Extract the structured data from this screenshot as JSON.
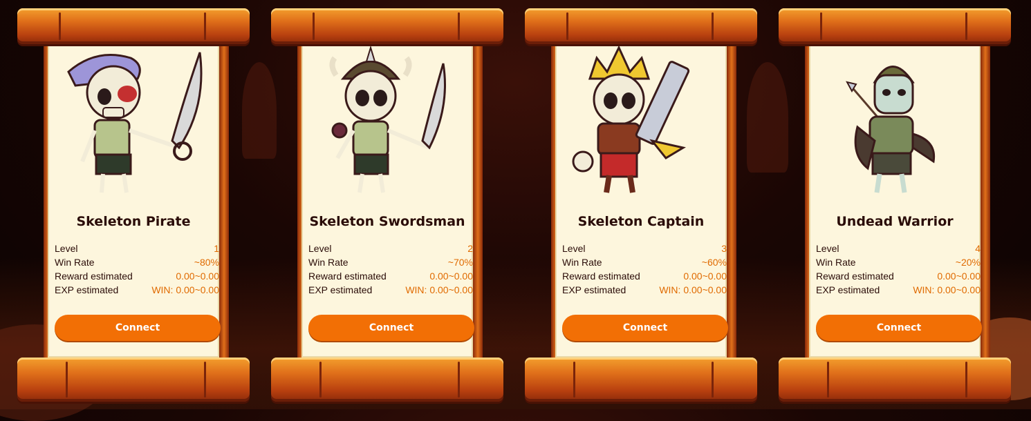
{
  "cards": [
    {
      "name": "Skeleton Pirate",
      "stats": {
        "level_label": "Level",
        "level": "1",
        "win_label": "Win Rate",
        "win": "~80%",
        "reward_label": "Reward estimated",
        "reward": "0.00~0.00",
        "exp_label": "EXP estimated",
        "exp": "WIN: 0.00~0.00"
      },
      "button": "Connect",
      "avatar": "skeleton-pirate-icon"
    },
    {
      "name": "Skeleton Swordsman",
      "stats": {
        "level_label": "Level",
        "level": "2",
        "win_label": "Win Rate",
        "win": "~70%",
        "reward_label": "Reward estimated",
        "reward": "0.00~0.00",
        "exp_label": "EXP estimated",
        "exp": "WIN: 0.00~0.00"
      },
      "button": "Connect",
      "avatar": "skeleton-swordsman-icon"
    },
    {
      "name": "Skeleton Captain",
      "stats": {
        "level_label": "Level",
        "level": "3",
        "win_label": "Win Rate",
        "win": "~60%",
        "reward_label": "Reward estimated",
        "reward": "0.00~0.00",
        "exp_label": "EXP estimated",
        "exp": "WIN: 0.00~0.00"
      },
      "button": "Connect",
      "avatar": "skeleton-captain-icon"
    },
    {
      "name": "Undead Warrior",
      "stats": {
        "level_label": "Level",
        "level": "4",
        "win_label": "Win Rate",
        "win": "~20%",
        "reward_label": "Reward estimated",
        "reward": "0.00~0.00",
        "exp_label": "EXP estimated",
        "exp": "WIN: 0.00~0.00"
      },
      "button": "Connect",
      "avatar": "undead-warrior-icon"
    }
  ],
  "colors": {
    "accent": "#f26f05",
    "value_text": "#e06a00",
    "title_text": "#2a0c08",
    "parchment": "#fdf6dd"
  }
}
